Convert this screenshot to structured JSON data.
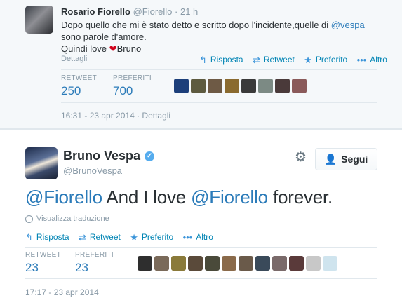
{
  "tweet1": {
    "name": "Rosario Fiorello",
    "handle": "@Fiorello",
    "time": "· 21 h",
    "text_part1": "Dopo quello che mi è stato detto e scritto dopo l'incidente,quelle di ",
    "text_mention": "@vespa",
    "text_line2": "sono parole d'amore.",
    "text_line3_a": "Quindi love ",
    "text_line3_b": "Bruno",
    "details_link": "Dettagli",
    "actions": {
      "reply": "Risposta",
      "retweet": "Retweet",
      "favorite": "Preferito",
      "more": "Altro"
    },
    "stats": {
      "retweet_label": "RETWEET",
      "retweet_value": "250",
      "favorites_label": "PREFERITI",
      "favorites_value": "700"
    },
    "footer": "16:31 - 23 apr 2014 · Dettagli",
    "thumb_colors": [
      "#1c3f7a",
      "#5d5a3f",
      "#6e5a45",
      "#8a6a2f",
      "#3a3a3a",
      "#7c8a84",
      "#4a3a3a",
      "#8a5a5a"
    ]
  },
  "tweet2": {
    "name": "Bruno Vespa",
    "handle": "@BrunoVespa",
    "follow_label": "Segui",
    "mention1": "@Fiorello",
    "text_mid": " And I love ",
    "mention2": "@Fiorello",
    "text_end": " forever.",
    "translate": "Visualizza traduzione",
    "actions": {
      "reply": "Risposta",
      "retweet": "Retweet",
      "favorite": "Preferito",
      "more": "Altro"
    },
    "stats": {
      "retweet_label": "RETWEET",
      "retweet_value": "23",
      "favorites_label": "PREFERITI",
      "favorites_value": "23"
    },
    "footer": "17:17 - 23 apr 2014",
    "thumb_colors": [
      "#2e2e2e",
      "#7a6a5a",
      "#8a7a3a",
      "#5a4a3a",
      "#4a4a3a",
      "#8a6a4a",
      "#6a5a4a",
      "#3a4a5a",
      "#7a6a6a",
      "#5a3a3a",
      "#c8c8c8",
      "#cfe4ee"
    ]
  },
  "colors": {
    "link": "#2b7bb9",
    "muted": "#8899a6",
    "heart": "#d0021b",
    "verified": "#55acee"
  }
}
